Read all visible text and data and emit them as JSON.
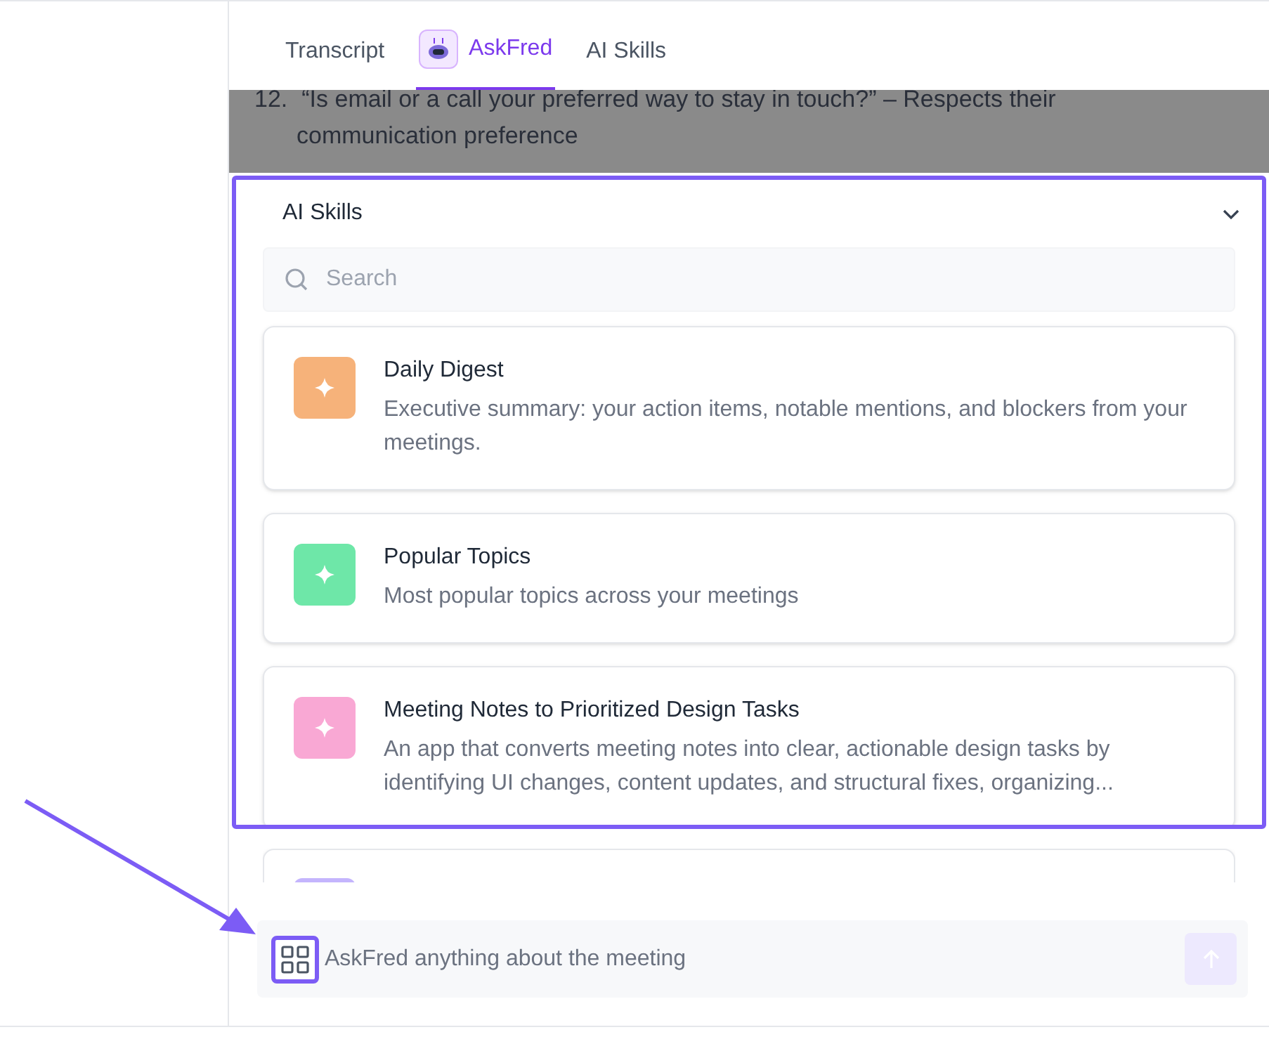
{
  "tabs": [
    {
      "label": "Transcript",
      "selected": false,
      "kind": "text"
    },
    {
      "label": "AskFred",
      "selected": true,
      "kind": "bot"
    },
    {
      "label": "AI Skills",
      "selected": false,
      "kind": "text"
    }
  ],
  "transcript": {
    "number": "12.",
    "lines": [
      "“Is email or a call your preferred way to stay in touch?” – Respects their",
      "communication preference"
    ]
  },
  "skills_panel": {
    "title": "AI Skills",
    "expanded": true,
    "search": {
      "placeholder": "Search"
    },
    "skills": [
      {
        "title": "Daily Digest",
        "description": "Executive summary: your action items, notable mentions, and blockers from your meetings.",
        "color": "#f6b27a"
      },
      {
        "title": "Popular Topics",
        "description": "Most popular topics across your meetings",
        "color": "#6ee7a8"
      },
      {
        "title": "Meeting Notes to Prioritized Design Tasks",
        "description": "An app that converts meeting notes into clear, actionable design tasks by identifying UI changes, content updates, and structural fixes, organizing...",
        "color": "#f9a8d4"
      },
      {
        "color": "#c4b5fd"
      }
    ]
  },
  "composer": {
    "placeholder": "AskFred anything about the meeting",
    "send_disabled": true
  }
}
